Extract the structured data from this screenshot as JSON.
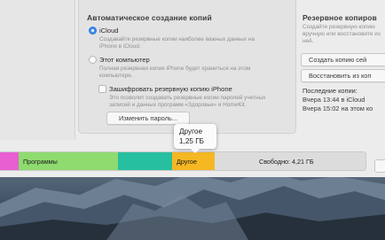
{
  "backup": {
    "auto_title": "Автоматическое создание копий",
    "icloud": {
      "label": "iCloud",
      "desc": "Создавайте резервные копии наиболее важных данных на iPhone в iCloud."
    },
    "computer": {
      "label": "Этот компьютер",
      "desc": "Полная резервная копия iPhone будет храниться на этом компьютере."
    },
    "encrypt": {
      "label": "Зашифровать резервную копию iPhone",
      "desc": "Это позволит создавать резервные копии паролей учетных записей и данных программ «Здоровье» и HomeKit."
    },
    "change_password_button": "Изменить пароль..."
  },
  "manual": {
    "title": "Резервное копиров",
    "desc": "Создайте резервную копию вручную или восстановите из неё.",
    "create_button": "Создать копию сей",
    "restore_button": "Восстановить из коп"
  },
  "latest": {
    "title": "Последние копии:",
    "line1": "Вчера 13:44 в iCloud",
    "line2": "Вчера 15:02 на этом ко"
  },
  "storage": {
    "segments": [
      {
        "name": "pink",
        "label": "",
        "color": "#e85fd2"
      },
      {
        "name": "programs",
        "label": "Программы",
        "color": "#8fdb70"
      },
      {
        "name": "teal",
        "label": "",
        "color": "#26bfa0"
      },
      {
        "name": "other",
        "label": "Другое",
        "color": "#f5b722"
      },
      {
        "name": "free",
        "label": "Свободно: 4,21 ГБ",
        "color": "#dcdcdc"
      }
    ]
  },
  "tooltip": {
    "title": "Другое",
    "size": "1,25 ГБ"
  }
}
